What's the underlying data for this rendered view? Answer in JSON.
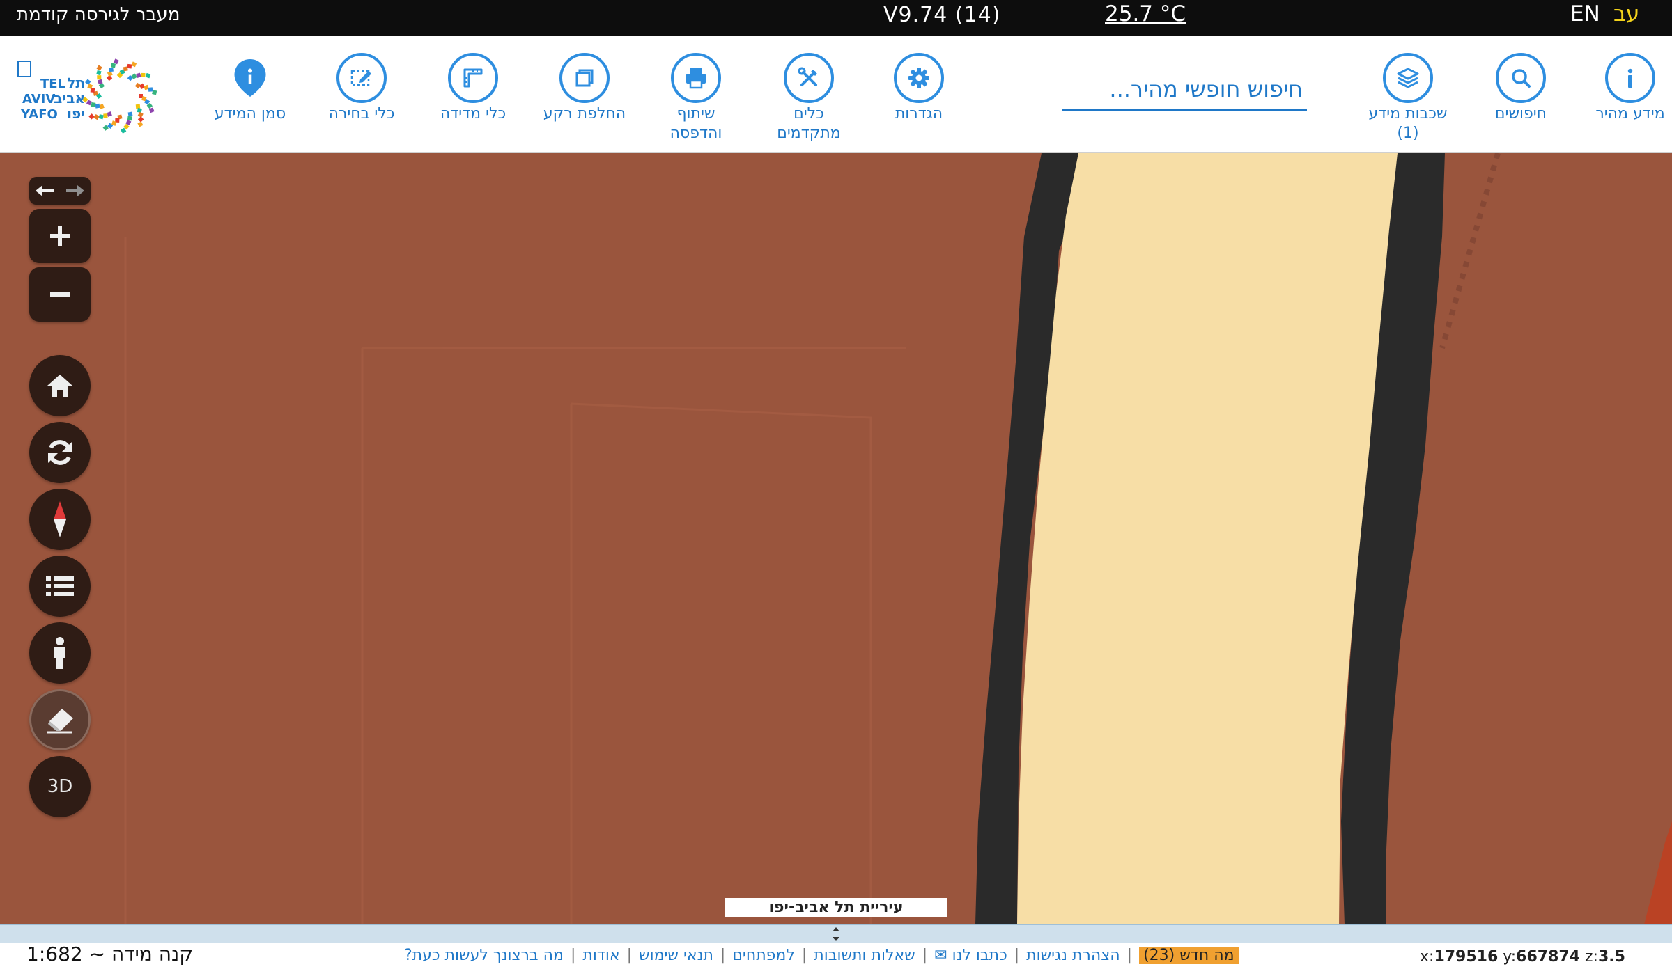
{
  "topbar": {
    "previous_version": "מעבר לגירסה קודמת",
    "version": "V9.74 (14)",
    "temperature": "25.7 °C",
    "lang_en": "EN",
    "lang_he": "עב"
  },
  "toolbar": {
    "search_placeholder": "חיפוש חופשי מהיר...",
    "tools": [
      {
        "id": "quick-info",
        "label": "מידע מהיר",
        "icon": "info-icon"
      },
      {
        "id": "searches",
        "label": "חיפושים",
        "icon": "search-icon"
      },
      {
        "id": "layers",
        "label": "שכבות מידע\n(1)",
        "icon": "layers-icon"
      },
      {
        "id": "settings",
        "label": "הגדרות",
        "icon": "gear-icon"
      },
      {
        "id": "advanced-tools",
        "label": "כלים\nמתקדמים",
        "icon": "tools-icon"
      },
      {
        "id": "share-print",
        "label": "שיתוף\nוהדפסה",
        "icon": "printer-icon"
      },
      {
        "id": "basemap",
        "label": "החלפת רקע",
        "icon": "basemap-icon"
      },
      {
        "id": "measure",
        "label": "כלי מדידה",
        "icon": "ruler-icon"
      },
      {
        "id": "select",
        "label": "כלי בחירה",
        "icon": "select-icon"
      },
      {
        "id": "mark-info",
        "label": "סמן המידע",
        "icon": "pin-icon"
      }
    ],
    "logo": {
      "line1": "תל",
      "line2": "אביב",
      "line3": "יפו",
      "en1": "TEL",
      "en2": "AVIV",
      "en3": "YAFO"
    }
  },
  "map": {
    "city_label": "עיריית תל אביב-יפו",
    "controls": {
      "label_3d": "3D"
    }
  },
  "bottom": {
    "scale": "קנה מידה ~ 1:682",
    "links": [
      "מה ברצונך לעשות כעת?",
      "אודות",
      "תנאי שימוש",
      "למפתחים",
      "שאלות ותשובות",
      "כתבו לנו ✉",
      "הצהרת נגישות"
    ],
    "whats_new": "מה חדש (23)",
    "coords": {
      "x_label": "x:",
      "x": "179516",
      "y_label": "y:",
      "y": "667874",
      "z_label": "z:",
      "z": "3.5"
    }
  },
  "colors": {
    "accent": "#1f78c8",
    "map_bg": "#9a553d",
    "road": "#f7dea6",
    "edge": "#2a2a2a",
    "control": "#2f1c15",
    "new_badge": "#f0a030"
  }
}
